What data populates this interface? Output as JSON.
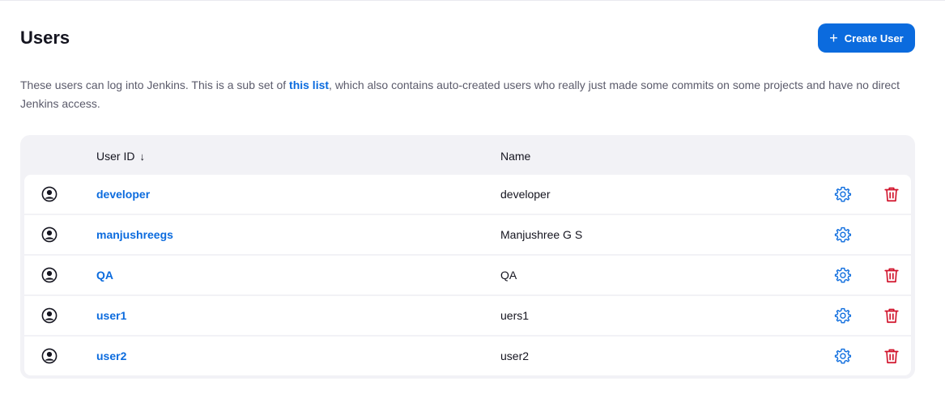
{
  "page": {
    "title": "Users",
    "create_button_label": "Create User",
    "description_before": "These users can log into Jenkins. This is a sub set of ",
    "description_link": "this list",
    "description_after": ", which also contains auto-created users who really just made some commits on some projects and have no direct Jenkins access."
  },
  "table": {
    "columns": {
      "user_id": "User ID",
      "sort_indicator": "↓",
      "name": "Name"
    },
    "rows": [
      {
        "user_id": "developer",
        "name": "developer",
        "deletable": true
      },
      {
        "user_id": "manjushreegs",
        "name": "Manjushree G S",
        "deletable": false
      },
      {
        "user_id": "QA",
        "name": "QA",
        "deletable": true
      },
      {
        "user_id": "user1",
        "name": "uers1",
        "deletable": true
      },
      {
        "user_id": "user2",
        "name": "user2",
        "deletable": true
      }
    ]
  },
  "icons": {
    "row_avatar": "user-circle-icon",
    "configure": "gear-icon",
    "delete": "trash-icon",
    "create": "plus-icon"
  },
  "colors": {
    "accent": "#0b6bde",
    "danger": "#d1132b",
    "table_bg": "#f2f2f6"
  }
}
